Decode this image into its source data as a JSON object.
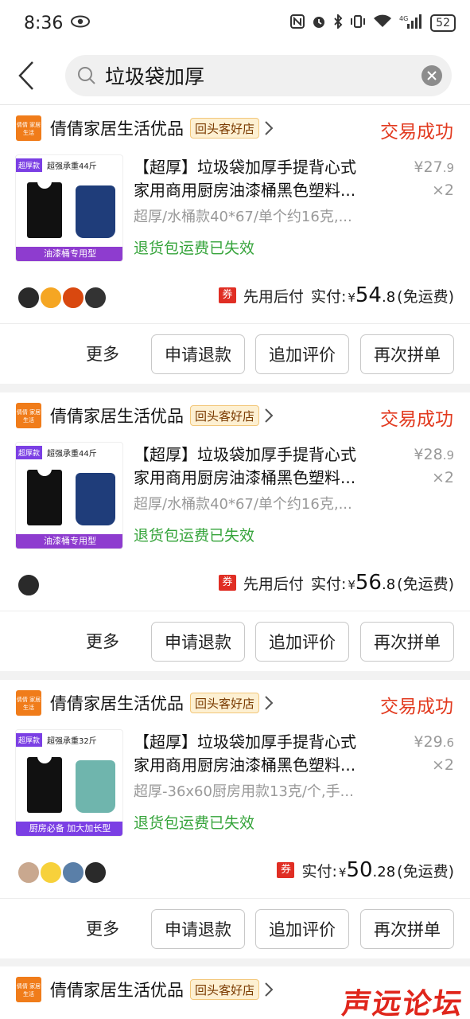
{
  "status_bar": {
    "time": "8:36",
    "battery": "52",
    "network": "4G"
  },
  "search": {
    "query": "垃圾袋加厚"
  },
  "orders": [
    {
      "shop_name": "倩倩家居生活优品",
      "shop_tag": "回头客好店",
      "logo_text": "倩倩 家居生活",
      "status": "交易成功",
      "image": {
        "top_left": "超厚款",
        "top_main": "超强承重44斤",
        "bottom_banner": "油漆桶专用型"
      },
      "title_line1": "【超厚】垃圾袋加厚手提背心式",
      "title_line2": "家用商用厨房油漆桶黑色塑料...",
      "spec": "超厚/水桶款40*67/单个约16克,...",
      "return_note": "退货包运费已失效",
      "unit_price_int": "¥27",
      "unit_price_dec": ".9",
      "quantity": "×2",
      "coupon": "券",
      "pay_method": "先用后付",
      "paid_label": "实付:",
      "currency": "¥",
      "amount_int": "54",
      "amount_dec": ".8",
      "ship_note": "(免运费)",
      "avatars": [
        "#2a2a2a",
        "#f5a623",
        "#d9480f",
        "#333333"
      ],
      "actions": {
        "more": "更多",
        "refund": "申请退款",
        "review": "追加评价",
        "rebuy": "再次拼单"
      }
    },
    {
      "shop_name": "倩倩家居生活优品",
      "shop_tag": "回头客好店",
      "logo_text": "倩倩 家居生活",
      "status": "交易成功",
      "image": {
        "top_left": "超厚款",
        "top_main": "超强承重44斤",
        "bottom_banner": "油漆桶专用型"
      },
      "title_line1": "【超厚】垃圾袋加厚手提背心式",
      "title_line2": "家用商用厨房油漆桶黑色塑料...",
      "spec": "超厚/水桶款40*67/单个约16克,...",
      "return_note": "退货包运费已失效",
      "unit_price_int": "¥28",
      "unit_price_dec": ".9",
      "quantity": "×2",
      "coupon": "券",
      "pay_method": "先用后付",
      "paid_label": "实付:",
      "currency": "¥",
      "amount_int": "56",
      "amount_dec": ".8",
      "ship_note": "(免运费)",
      "avatars": [
        "#2a2a2a"
      ],
      "actions": {
        "more": "更多",
        "refund": "申请退款",
        "review": "追加评价",
        "rebuy": "再次拼单"
      }
    },
    {
      "shop_name": "倩倩家居生活优品",
      "shop_tag": "回头客好店",
      "logo_text": "倩倩 家居生活",
      "status": "交易成功",
      "image": {
        "top_left": "超厚款",
        "top_main": "超强承重32斤",
        "bottom_banner": "厨房必备 加大加长型"
      },
      "title_line1": "【超厚】垃圾袋加厚手提背心式",
      "title_line2": "家用商用厨房油漆桶黑色塑料...",
      "spec": "超厚-36x60厨房用款13克/个,手...",
      "return_note": "退货包运费已失效",
      "unit_price_int": "¥29",
      "unit_price_dec": ".6",
      "quantity": "×2",
      "coupon": "券",
      "pay_method": "",
      "paid_label": "实付:",
      "currency": "¥",
      "amount_int": "50",
      "amount_dec": ".28",
      "ship_note": "(免运费)",
      "avatars": [
        "#c9a88f",
        "#f7d13b",
        "#5a7fa8",
        "#2a2a2a"
      ],
      "actions": {
        "more": "更多",
        "refund": "申请退款",
        "review": "追加评价",
        "rebuy": "再次拼单"
      }
    }
  ],
  "partial_order": {
    "shop_name": "倩倩家居生活优品",
    "shop_tag": "回头客好店",
    "logo_text": "倩倩 家居生活"
  },
  "watermark": "声远论坛",
  "colors": {
    "accent_red": "#e23a1f",
    "green": "#36a43b",
    "logo_orange": "#f07c1a",
    "tag_bg": "#fdf0d2"
  }
}
